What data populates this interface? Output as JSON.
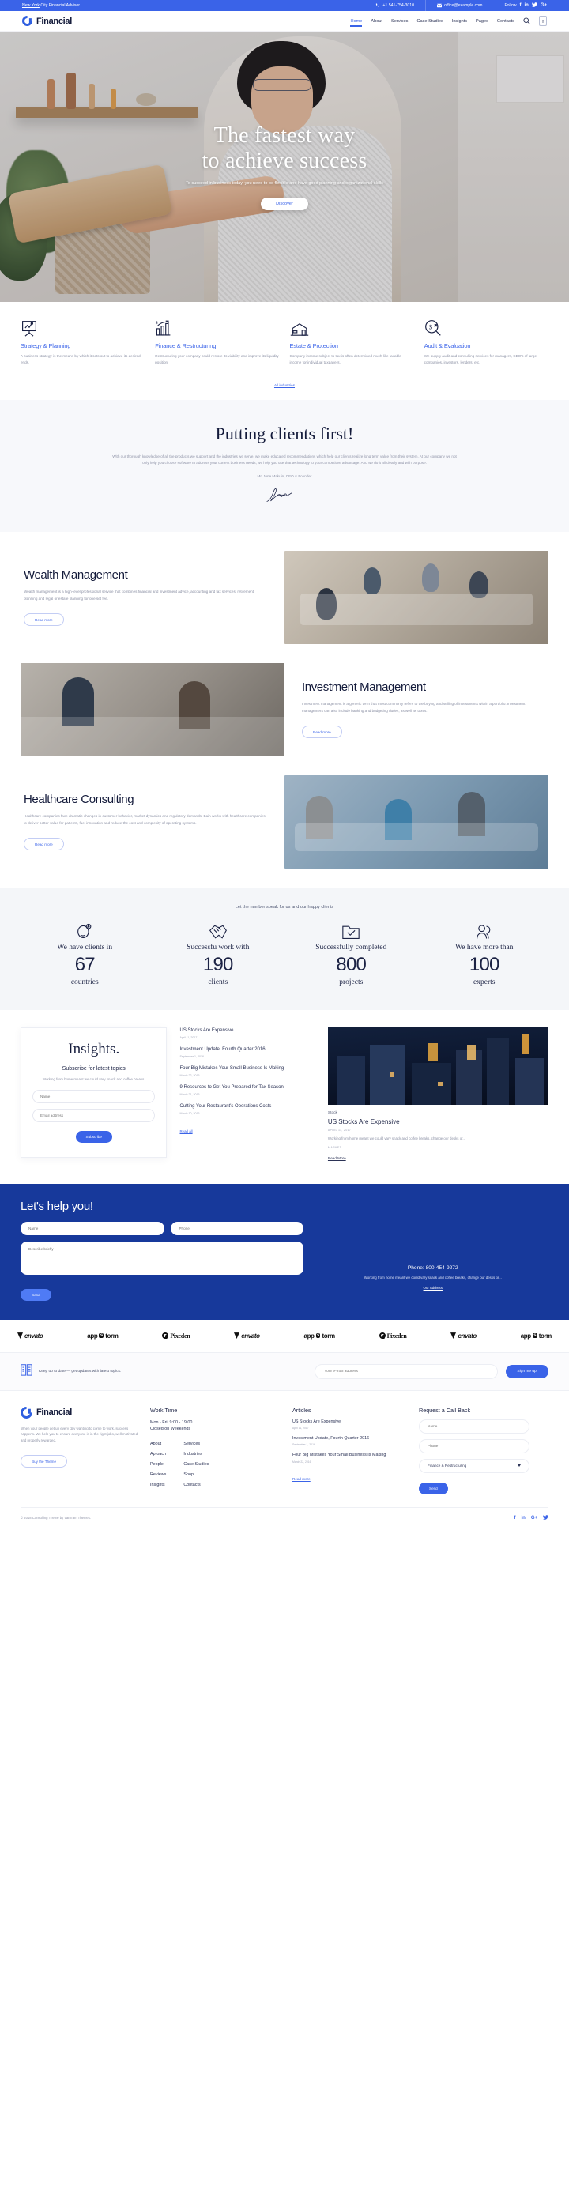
{
  "topbar": {
    "tagline_link": "New York",
    "tagline_rest": " City Financial Advisor",
    "phone": "+1 541-754-3010",
    "email": "office@example.com",
    "follow_label": "Follow",
    "socials": [
      "f",
      "in",
      "t",
      "G+"
    ]
  },
  "header": {
    "brand": "Financial",
    "nav": [
      "Home",
      "About",
      "Services",
      "Case Studies",
      "Insights",
      "Pages",
      "Contacts"
    ],
    "active_nav": "Home",
    "search_icon": "search-icon",
    "cart_icon": "cart-icon"
  },
  "hero": {
    "title_line1": "The fastest way",
    "title_line2": "to achieve success",
    "subtitle": "To succeed in business today, you need to be flexible and have good planning and organizational skills",
    "button": "Discover"
  },
  "services": {
    "items": [
      {
        "icon": "presentation-chart-icon",
        "title": "Strategy & Planning",
        "text": "A business strategy is the means by which it sets out to achieve its desired ends."
      },
      {
        "icon": "bar-chart-growth-icon",
        "title": "Finance & Restructuring",
        "text": "Restructuring your company could restore its viability and improve its liquidity position."
      },
      {
        "icon": "house-icon",
        "title": "Estate & Protection",
        "text": "Company income subject to tax is often determined much like taxable income for individual taxpayers."
      },
      {
        "icon": "dollar-magnifier-icon",
        "title": "Audit & Evaluation",
        "text": "We supply audit and consulting services for managers, CEO's of large companies, investors, lenders, etc."
      }
    ],
    "all_link": "All industries"
  },
  "clients": {
    "heading": "Putting clients first!",
    "paragraph": "With our thorough knowledge of all the products we support and the industries we serve, we make educated recommendations which help our clients realize long term value from their system. At our company we not only help you choose software to address your current business needs, we help you use that technology to your competitive advantage. And we do it all clearly and with purpose.",
    "author": "Mr. Jone Makuin, CEO & Founder"
  },
  "features": [
    {
      "title": "Wealth Management",
      "text": "Wealth management is a high-level professional service that combines financial and investment advice, accounting and tax services, retirement planning and legal or estate planning for one set fee.",
      "button": "Read more",
      "image": "meeting-photo"
    },
    {
      "title": "Investment Management",
      "text": "Investment management is a generic term that most commonly refers to the buying and selling of investments within a portfolio. Investment management can also include banking and budgeting duties, as well as taxes.",
      "button": "Read more",
      "image": "conversation-photo"
    },
    {
      "title": "Healthcare Consulting",
      "text": "Healthcare companies face dramatic changes in customer behavior, market dynamics and regulatory demands. Bain works with healthcare companies to deliver better value for patients, fuel innovation and reduce the cost and complexity of operating systems.",
      "button": "Read more",
      "image": "healthcare-photo"
    }
  ],
  "stats": {
    "lead": "Let the number speak for us and our happy clients",
    "items": [
      {
        "icon": "globe-pin-icon",
        "top": "We have clients in",
        "number": "67",
        "unit": "countries"
      },
      {
        "icon": "handshake-icon",
        "top": "Successfu work with",
        "number": "190",
        "unit": "clients"
      },
      {
        "icon": "folder-check-icon",
        "top": "Successfully completed",
        "number": "800",
        "unit": "projects"
      },
      {
        "icon": "people-icon",
        "top": "We have more than",
        "number": "100",
        "unit": "experts"
      }
    ]
  },
  "insights": {
    "card": {
      "heading": "Insights.",
      "subheading": "Subscribe for latest topics",
      "text": "Working from home meant we could vary snack and coffee breaks.",
      "name_placeholder": "Name",
      "email_placeholder": "Email address",
      "button": "Subscribe"
    },
    "list": [
      {
        "title": "US Stocks Are Expensive",
        "date": "April 11, 2017"
      },
      {
        "title": "Investment Update, Fourth Quarter 2016",
        "date": "September 1, 2016"
      },
      {
        "title": "Four Big Mistakes Your Small Business Is Making",
        "date": "March 22, 2016"
      },
      {
        "title": "9 Resources to Get You Prepared for Tax Season",
        "date": "March 21, 2016"
      },
      {
        "title": "Cutting Your Restaurant's Operations Costs",
        "date": "March 10, 2016"
      }
    ],
    "read_all": "Read all",
    "featured": {
      "category": "Stock",
      "title": "US Stocks Are Expensive",
      "date": "APRIL 11, 2017",
      "excerpt": "Working from home meant we could vary snack and coffee breaks, change our desks or...",
      "tag": "MARKET",
      "read_more": "Read More",
      "image": "city-skyline-night-photo"
    }
  },
  "help": {
    "heading": "Let's help you!",
    "name_placeholder": "Name",
    "phone_placeholder": "Phone",
    "describe_placeholder": "Describe briefly",
    "send_button": "Send",
    "phone_line": "Phone: 800-454-9272",
    "note": "Working from home meant we could vary snack and coffee breaks, change our desks or...",
    "address_link": "Our Address"
  },
  "logos": [
    "envato",
    "appstorm",
    "Pixeden",
    "envato",
    "appstorm",
    "Pixeden",
    "envato",
    "appstorm"
  ],
  "subscribe_bar": {
    "icon": "book-icon",
    "text": "Keep up to date — get updates with latest topics.",
    "placeholder": "Your e-mail address",
    "button": "Sign me up!"
  },
  "footer": {
    "brand": "Financial",
    "about": "When your people get up every day wanting to come to work, success happens. We help you to ensure everyone is in the right jobs, well motivated and properly rewarded.",
    "buy_button": "Buy the Theme",
    "work_time_heading": "Work Time",
    "work_time_line1": "Mon - Fri: 9:00 - 19:00",
    "work_time_line2": "Closed on Weekends",
    "links_col1": [
      "About",
      "Aproach",
      "People",
      "Reviews",
      "Insights"
    ],
    "links_col2": [
      "Services",
      "Industries",
      "Case Studies",
      "Shop",
      "Contacts"
    ],
    "articles_heading": "Articles",
    "articles": [
      {
        "title": "US Stocks Are Expensive",
        "date": "April 11, 2017"
      },
      {
        "title": "Investment Update, Fourth Quarter 2016",
        "date": "September 1, 2016"
      },
      {
        "title": "Four Big Mistakes Your Small Business Is Making",
        "date": "March 22, 2016"
      }
    ],
    "read_more": "Read more",
    "callback_heading": "Request a Call Back",
    "callback_name": "Name",
    "callback_phone": "Phone",
    "callback_select": "Finance & Restructuring",
    "callback_send": "Send",
    "copyright": "© 2018 Consulting Theme by VamTam Themes.",
    "socials": [
      "f",
      "in",
      "G+",
      "t"
    ]
  },
  "colors": {
    "accent": "#3a63e8",
    "deep_blue": "#17399b",
    "dark": "#1b2244",
    "muted": "#8b90a4"
  }
}
